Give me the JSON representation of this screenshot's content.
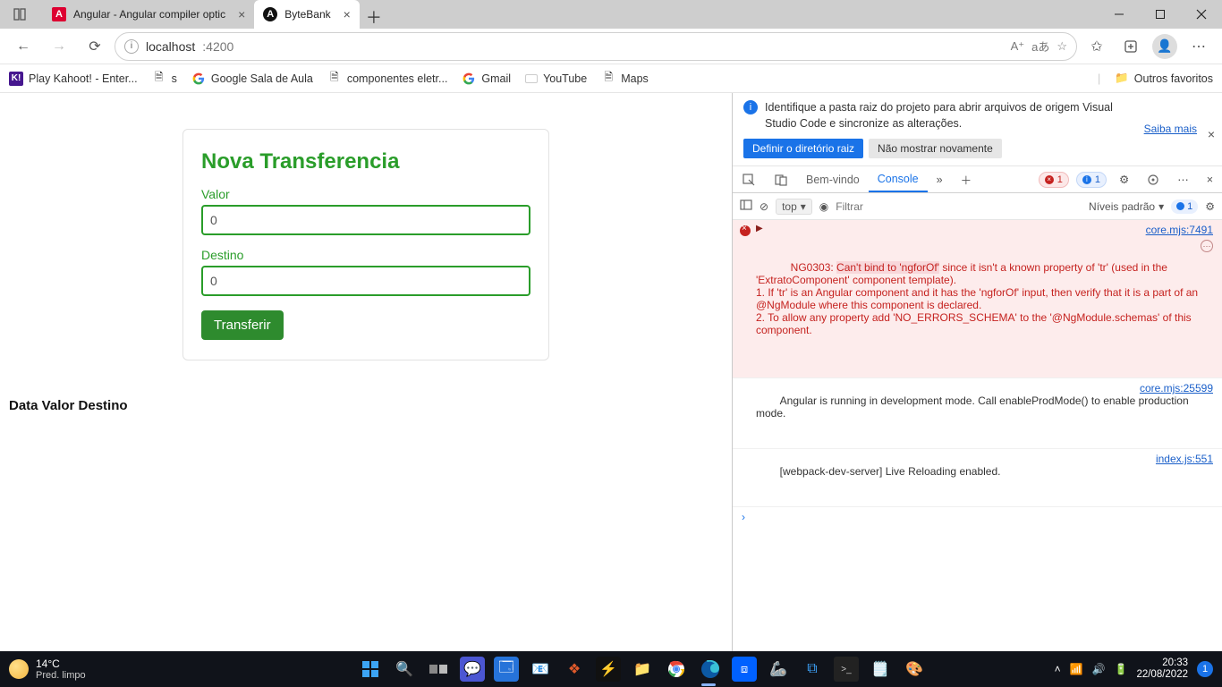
{
  "browser": {
    "tabs": [
      {
        "title": "Angular - Angular compiler optic",
        "favicon": "angular"
      },
      {
        "title": "ByteBank",
        "favicon": "bytebank"
      }
    ],
    "active_tab": 1,
    "url_host": "localhost",
    "url_port": ":4200",
    "bookmarks": [
      {
        "label": "Play Kahoot! - Enter...",
        "icon": "kahoot"
      },
      {
        "label": "s",
        "icon": "page"
      },
      {
        "label": "Google Sala de Aula",
        "icon": "google"
      },
      {
        "label": "componentes eletr...",
        "icon": "page"
      },
      {
        "label": "Gmail",
        "icon": "google"
      },
      {
        "label": "YouTube",
        "icon": "blank"
      },
      {
        "label": "Maps",
        "icon": "page"
      }
    ],
    "other_bookmarks_label": "Outros favoritos"
  },
  "page": {
    "card_title": "Nova Transferencia",
    "valor_label": "Valor",
    "valor_value": "0",
    "destino_label": "Destino",
    "destino_value": "0",
    "transfer_button": "Transferir",
    "extrato_header": "Data Valor Destino"
  },
  "devtools": {
    "banner_text": "Identifique a pasta raiz do projeto para abrir arquivos de origem Visual Studio Code e sincronize as alterações.",
    "banner_primary": "Definir o diretório raiz",
    "banner_secondary": "Não mostrar novamente",
    "banner_more": "Saiba mais",
    "tabs": {
      "welcome": "Bem-vindo",
      "console": "Console"
    },
    "error_count": "1",
    "info_count": "1",
    "filter": {
      "context": "top",
      "placeholder": "Filtrar",
      "levels": "Níveis padrão",
      "issue_count": "1"
    },
    "messages": {
      "err_prefix": "NG0303: ",
      "err_hl": "Can't bind to 'ngforOf'",
      "err_body": " since it isn't a known property of 'tr' (used in the 'ExtratoComponent' component template).\n1. If 'tr' is an Angular component and it has the 'ngforOf' input, then verify that it is a part of an @NgModule where this component is declared.\n2. To allow any property add 'NO_ERRORS_SCHEMA' to the '@NgModule.schemas' of this component.",
      "err_src": "core.mjs:7491",
      "devmode": "Angular is running in development mode. Call enableProdMode() to enable production mode.",
      "devmode_src": "core.mjs:25599",
      "webpack": "[webpack-dev-server] Live Reloading enabled.",
      "webpack_src": "index.js:551"
    },
    "prompt": "›"
  },
  "taskbar": {
    "weather_temp": "14°C",
    "weather_desc": "Pred. limpo",
    "time": "20:33",
    "date": "22/08/2022",
    "notif_count": "1"
  }
}
